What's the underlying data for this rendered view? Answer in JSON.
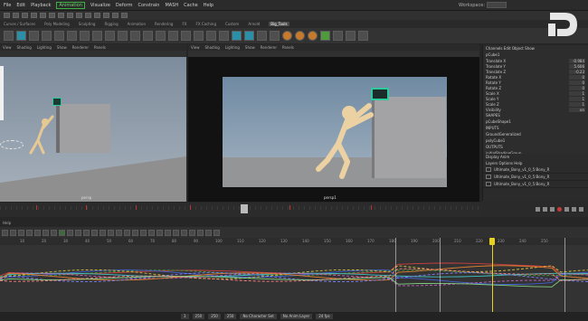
{
  "menubar": {
    "items": [
      "File",
      "Edit",
      "Playback",
      "Visualize",
      "Deform",
      "Constrain",
      "MASH",
      "Cache",
      "Help"
    ],
    "mode": "Animation",
    "workspace_label": "Workspace:"
  },
  "shelf": {
    "tabs": [
      "Curves / Surfaces",
      "Poly Modeling",
      "Sculpting",
      "Rigging",
      "Animation",
      "Rendering",
      "FX",
      "FX Caching",
      "Custom",
      "Arnold",
      "Bifrost",
      "MASH",
      "Motion Graphics",
      "XGen",
      "Big_Tools"
    ],
    "active_tab": "Big_Tools"
  },
  "viewport_left": {
    "menu": [
      "View",
      "Shading",
      "Lighting",
      "Show",
      "Renderer",
      "Panels"
    ],
    "camera": "persp"
  },
  "viewport_right": {
    "menu": [
      "View",
      "Shading",
      "Lighting",
      "Show",
      "Renderer",
      "Panels"
    ],
    "camera": "persp1"
  },
  "channel_box": {
    "tabs": [
      "Channels",
      "Edit",
      "Object",
      "Show"
    ],
    "object": "pCube1",
    "channels": [
      {
        "name": "Translate X",
        "value": "-0.984"
      },
      {
        "name": "Translate Y",
        "value": "5.606"
      },
      {
        "name": "Translate Z",
        "value": "-0.23"
      },
      {
        "name": "Rotate X",
        "value": "0"
      },
      {
        "name": "Rotate Y",
        "value": "0"
      },
      {
        "name": "Rotate Z",
        "value": "0"
      },
      {
        "name": "Scale X",
        "value": "1"
      },
      {
        "name": "Scale Y",
        "value": "1"
      },
      {
        "name": "Scale Z",
        "value": "1"
      },
      {
        "name": "Visibility",
        "value": "on"
      }
    ],
    "shapes_label": "SHAPES",
    "shape_name": "pCubeShape1",
    "inputs_label": "INPUTS",
    "inputs": [
      "GroundGeneralized",
      "polyCube1"
    ],
    "outputs_label": "OUTPUTS",
    "outputs": [
      "initialShadingGroup"
    ]
  },
  "layers": {
    "tabs": [
      "Display",
      "Anim"
    ],
    "menu": [
      "Layers",
      "Options",
      "Help"
    ],
    "rows": [
      "Ultimate_Bony_v1_0_5:Bony_R",
      "Ultimate_Bony_v1_0_5:Bony_R",
      "Ultimate_Bony_v1_0_5:Bony_R"
    ]
  },
  "graph_editor": {
    "menu_label": "Help",
    "ruler": [
      "10",
      "20",
      "30",
      "40",
      "50",
      "60",
      "70",
      "80",
      "90",
      "100",
      "110",
      "120",
      "130",
      "140",
      "150",
      "160",
      "170",
      "180",
      "190",
      "200",
      "210",
      "220",
      "230",
      "240",
      "250"
    ]
  },
  "bottom": {
    "start": "1",
    "end": "250",
    "range_start": "250",
    "range_end": "250",
    "character_set": "No Character Set",
    "anim_layer": "No Anim Layer",
    "fps": "24 fps"
  },
  "colors": {
    "accent_green": "#3cb043",
    "time_cursor": "#e8d21a",
    "key_red": "#c73a3a"
  }
}
